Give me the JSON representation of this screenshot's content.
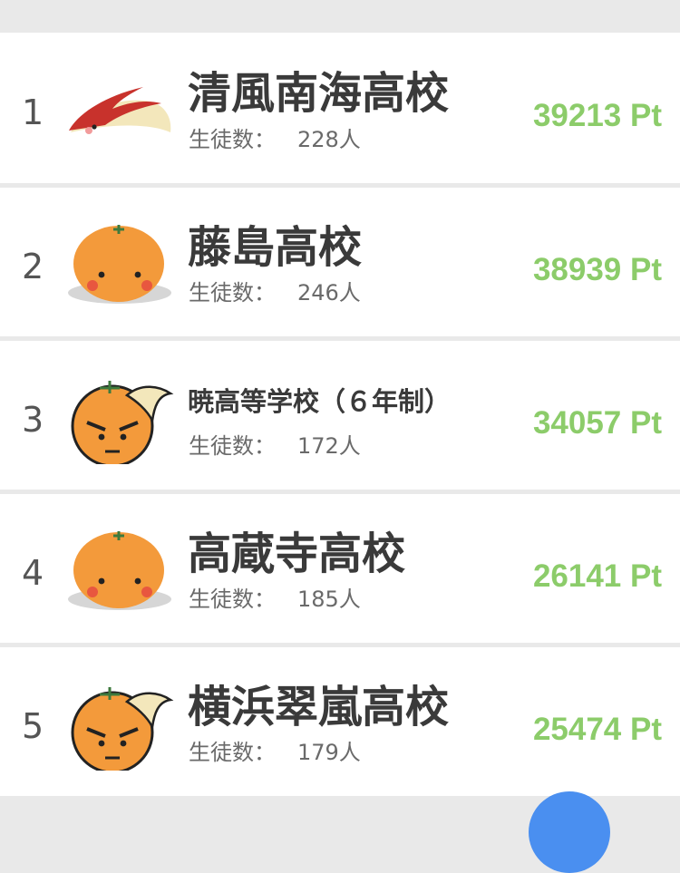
{
  "ranking": {
    "count_label": "生徒数：",
    "point_unit": "Pt",
    "schools": [
      {
        "rank": "1",
        "name": "清風南海高校",
        "students": "228人",
        "points": "39213",
        "avatar": "bird-icon"
      },
      {
        "rank": "2",
        "name": "藤島高校",
        "students": "246人",
        "points": "38939",
        "avatar": "orange-mascot-icon"
      },
      {
        "rank": "3",
        "name": "暁高等学校（６年制）",
        "students": "172人",
        "points": "34057",
        "avatar": "angry-orange-mascot-icon"
      },
      {
        "rank": "4",
        "name": "高蔵寺高校",
        "students": "185人",
        "points": "26141",
        "avatar": "orange-mascot-icon"
      },
      {
        "rank": "5",
        "name": "横浜翠嵐高校",
        "students": "179人",
        "points": "25474",
        "avatar": "angry-orange-mascot-icon"
      }
    ]
  },
  "colors": {
    "points": "#8ccc6a",
    "orange": "#f39a3b",
    "bird_red": "#c8322c",
    "fab_blue": "#4a8ff0"
  }
}
